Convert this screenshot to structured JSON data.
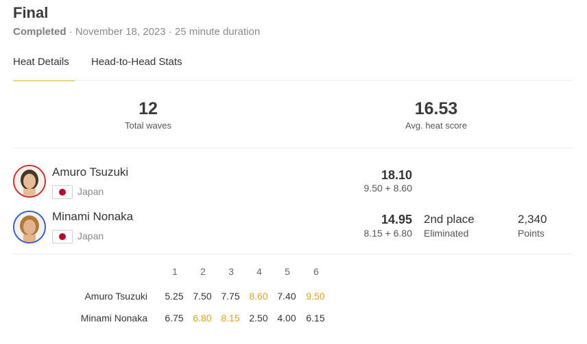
{
  "heat": {
    "title": "Final",
    "status": "Completed",
    "date_text": " · November 18, 2023 · 25 minute duration"
  },
  "tabs": [
    {
      "label": "Heat Details",
      "active": true
    },
    {
      "label": "Head-to-Head Stats",
      "active": false
    }
  ],
  "stats": {
    "total_waves": {
      "value": "12",
      "label": "Total waves"
    },
    "avg_score": {
      "value": "16.53",
      "label": "Avg. heat score"
    }
  },
  "athletes": [
    {
      "name": "Amuro Tsuzuki",
      "country": "Japan",
      "total": "18.10",
      "breakdown": "9.50 + 8.60",
      "jersey_color": "#c9302c"
    },
    {
      "name": "Minami Nonaka",
      "country": "Japan",
      "total": "14.95",
      "breakdown": "8.15 + 6.80",
      "jersey_color": "#3b5ccc",
      "place": "2nd place",
      "place_sub": "Eliminated",
      "points": "2,340",
      "points_sub": "Points"
    }
  ],
  "wave_table": {
    "headers": [
      "1",
      "2",
      "3",
      "4",
      "5",
      "6"
    ],
    "highlight_color": "#e0a126",
    "rows": [
      {
        "name": "Amuro Tsuzuki",
        "scores": [
          "5.25",
          "7.50",
          "7.75",
          "8.60",
          "7.40",
          "9.50"
        ],
        "highlighted": [
          3,
          5
        ]
      },
      {
        "name": "Minami Nonaka",
        "scores": [
          "6.75",
          "6.80",
          "8.15",
          "2.50",
          "4.00",
          "6.15"
        ],
        "highlighted": [
          1,
          2
        ]
      }
    ]
  }
}
